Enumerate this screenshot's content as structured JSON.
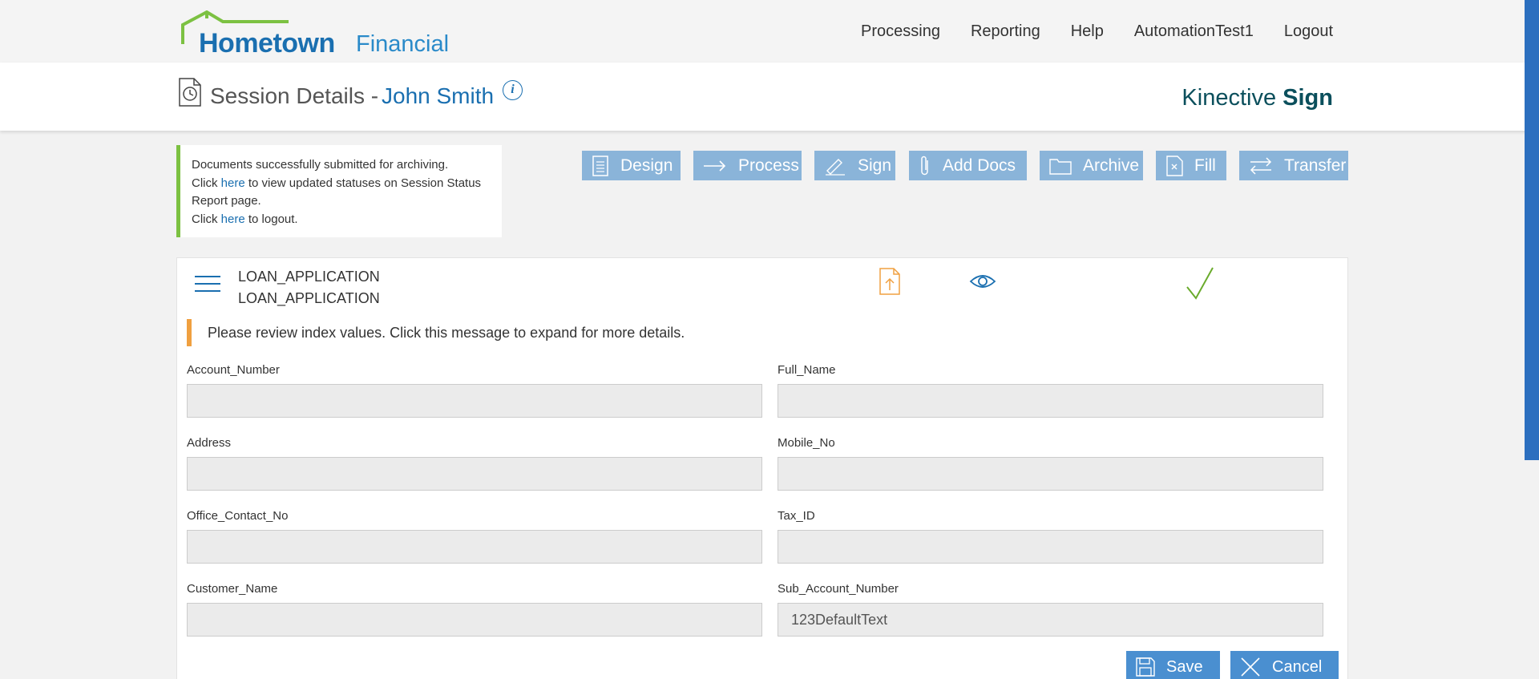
{
  "header": {
    "brand_name": "Hometown",
    "brand_suffix": "Financial",
    "nav": [
      "Processing",
      "Reporting",
      "Help",
      "AutomationTest1",
      "Logout"
    ]
  },
  "session": {
    "title": "Session Details -",
    "customer": "John Smith",
    "product_name": "Kinective",
    "product_suffix": "Sign"
  },
  "notice": {
    "line1": "Documents successfully submitted for archiving.",
    "click": "Click",
    "link": "here",
    "line2_rest": "to view updated statuses on Session Status Report page.",
    "line3_rest": "to logout."
  },
  "actions": [
    {
      "label": "Design",
      "icon": "design-icon"
    },
    {
      "label": "Process",
      "icon": "arrow-right-icon"
    },
    {
      "label": "Sign",
      "icon": "pen-icon"
    },
    {
      "label": "Add Docs",
      "icon": "paperclip-icon"
    },
    {
      "label": "Archive",
      "icon": "folder-icon"
    },
    {
      "label": "Fill",
      "icon": "fill-doc-icon"
    },
    {
      "label": "Transfer",
      "icon": "transfer-icon"
    }
  ],
  "document": {
    "name": "LOAN_APPLICATION",
    "type": "LOAN_APPLICATION",
    "review_message": "Please review index values. Click this message to expand for more details."
  },
  "fields": {
    "account_number": {
      "label": "Account_Number",
      "value": ""
    },
    "full_name": {
      "label": "Full_Name",
      "value": ""
    },
    "address": {
      "label": "Address",
      "value": ""
    },
    "mobile_no": {
      "label": "Mobile_No",
      "value": ""
    },
    "office_contact_no": {
      "label": "Office_Contact_No",
      "value": ""
    },
    "tax_id": {
      "label": "Tax_ID",
      "value": ""
    },
    "customer_name": {
      "label": "Customer_Name",
      "value": ""
    },
    "sub_account_number": {
      "label": "Sub_Account_Number",
      "value": "123DefaultText"
    }
  },
  "buttons": {
    "save": "Save",
    "cancel": "Cancel"
  },
  "colors": {
    "brand_blue": "#1a6fb0",
    "action_button": "#8ab4d9",
    "primary_button": "#4a8fd0",
    "success_border": "#7cc142",
    "warning_border": "#f0a040",
    "kinective_teal": "#0b4f5c"
  }
}
